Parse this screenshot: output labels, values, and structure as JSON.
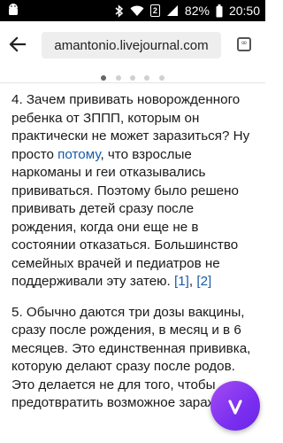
{
  "status_bar": {
    "battery": "82%",
    "time": "20:50",
    "sim_label": "2",
    "icons": [
      "bluetooth-icon",
      "wifi-icon",
      "sim-icon",
      "signal-icon",
      "battery-icon"
    ]
  },
  "toolbar": {
    "url": "amantonio.livejournal.com",
    "tabs_count": "∞"
  },
  "pager": {
    "pages": 5,
    "active_index": 0
  },
  "article": {
    "p1_text_a": "4. Зачем прививать новорожденного ребенка от ЗППП, которым он практически не может заразиться? Ну просто ",
    "p1_link": "потому",
    "p1_text_b": ", что взрослые наркоманы и геи отказывались прививаться. Поэтому было решено прививать детей сразу после рождения, когда они еще не в состоянии отказаться. Большинство семейных врачей и педиатров не поддерживали эту затею. ",
    "ref1": "[1]",
    "ref_sep": ", ",
    "ref2": "[2]",
    "p2_text": "5. Обычно даются три дозы вакцины, сразу после рождения, в месяц и в 6 месяцев. Это единственная прививка, которую делают сразу после родов. Это делается не для того, чтобы предотвратить возможное заражение"
  },
  "colors": {
    "link": "#1a5ba8",
    "assistant": "#7b2ff0"
  }
}
